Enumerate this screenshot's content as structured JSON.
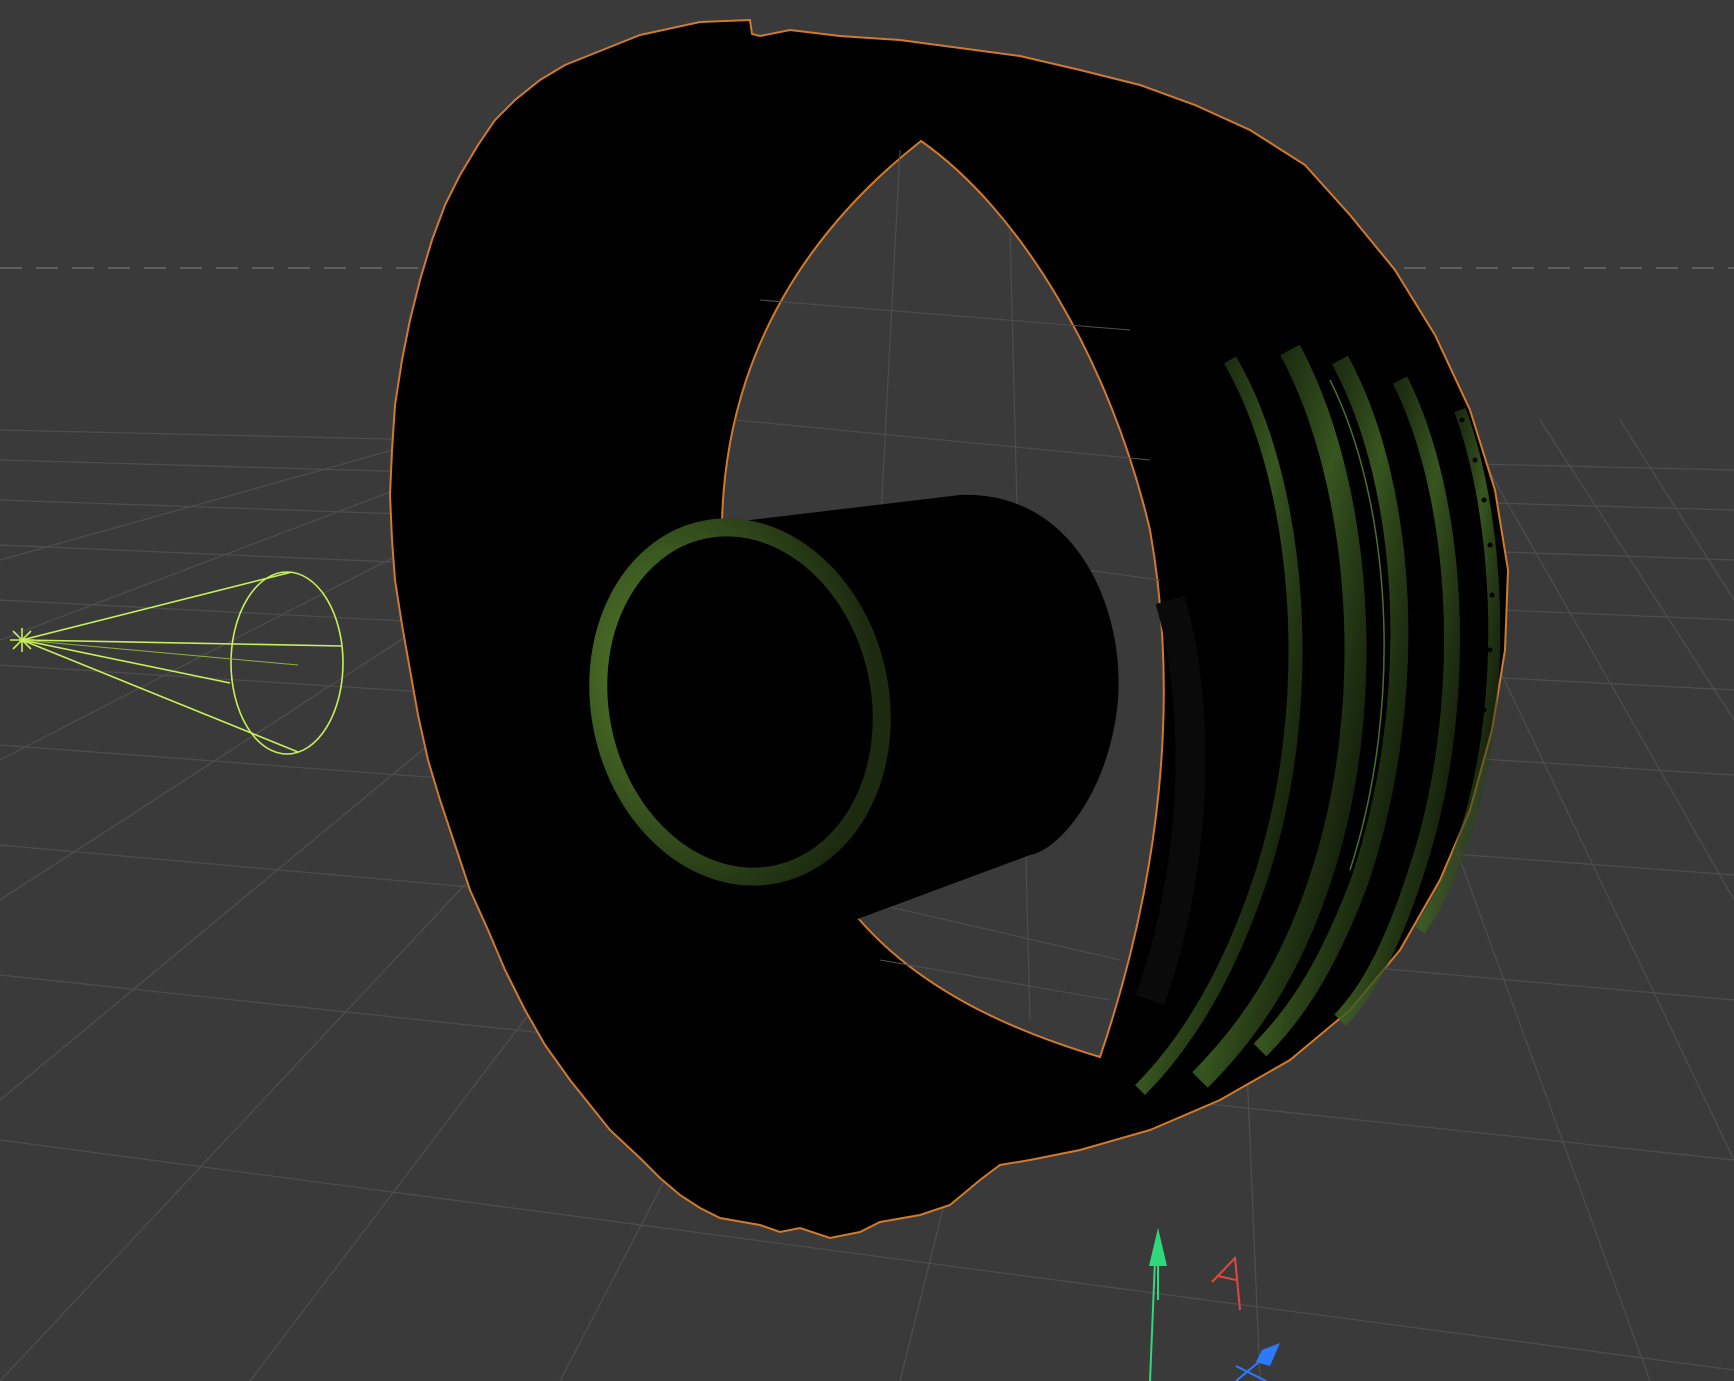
{
  "viewport": {
    "background": "#3a3a3a",
    "grid_color": "#4d4d4d",
    "horizon_color": "#6a6a6a"
  },
  "scene": {
    "tire_fill": "#000000",
    "outline_color": "#d27a2c",
    "rim_glow_color": "#3f5a22",
    "highlight_color": "#5f8a35",
    "light_color": "#c7f05a"
  },
  "gizmo": {
    "y_color": "#2fd87a",
    "x_color": "#e0473f",
    "z_color": "#2c7bff"
  }
}
